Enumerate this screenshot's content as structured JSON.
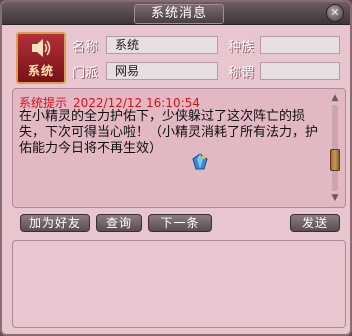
{
  "window": {
    "title": "系统消息"
  },
  "sender": {
    "badge_label": "系统"
  },
  "fields": {
    "name_label": "名称",
    "name_value": "系统",
    "race_label": "种族",
    "race_value": "",
    "sect_label": "门派",
    "sect_value": "网易",
    "title_label": "称谓",
    "title_value": ""
  },
  "message": {
    "tag": "系统提示",
    "timestamp": "2022/12/12 16:10:54",
    "body": "在小精灵的全力护佑下，少侠躲过了这次阵亡的损失，下次可得当心啦！（小精灵消耗了所有法力，护佑能力今日将不再生效）"
  },
  "buttons": {
    "add_friend": "加为好友",
    "query": "查询",
    "next": "下一条",
    "send": "发送"
  },
  "reply": {
    "value": ""
  },
  "icons": {
    "speaker": "speaker-icon",
    "gem": "gem-icon",
    "close": "close-icon"
  },
  "colors": {
    "panel_bg": "#e8c6cf",
    "message_bg": "#e2b8c3",
    "tag_red": "#d8101c",
    "titlebar": "#4a3e42",
    "badge_red": "#9a1f28"
  }
}
